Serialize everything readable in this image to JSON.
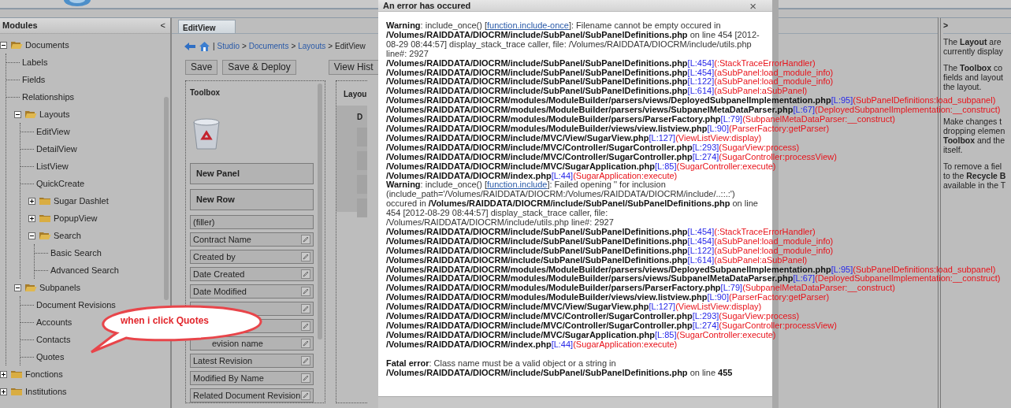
{
  "modules": {
    "title": "Modules",
    "collapse": "<",
    "tree": [
      {
        "label": "Documents",
        "kind": "folder",
        "expanded": true,
        "children": [
          {
            "label": "Labels",
            "kind": "leaf"
          },
          {
            "label": "Fields",
            "kind": "leaf"
          },
          {
            "label": "Relationships",
            "kind": "leaf"
          },
          {
            "label": "Layouts",
            "kind": "folder",
            "expanded": true,
            "children": [
              {
                "label": "EditView",
                "kind": "leaf"
              },
              {
                "label": "DetailView",
                "kind": "leaf"
              },
              {
                "label": "ListView",
                "kind": "leaf"
              },
              {
                "label": "QuickCreate",
                "kind": "leaf"
              },
              {
                "label": "Sugar Dashlet",
                "kind": "folder",
                "expanded": false
              },
              {
                "label": "PopupView",
                "kind": "folder",
                "expanded": false
              },
              {
                "label": "Search",
                "kind": "folder",
                "expanded": true,
                "children": [
                  {
                    "label": "Basic Search",
                    "kind": "leaf"
                  },
                  {
                    "label": "Advanced Search",
                    "kind": "leaf"
                  }
                ]
              }
            ]
          },
          {
            "label": "Subpanels",
            "kind": "folder",
            "expanded": true,
            "children": [
              {
                "label": "Document Revisions",
                "kind": "leaf"
              },
              {
                "label": "Accounts",
                "kind": "leaf"
              },
              {
                "label": "Contacts",
                "kind": "leaf"
              },
              {
                "label": "Quotes",
                "kind": "leaf"
              }
            ]
          }
        ]
      },
      {
        "label": "Fonctions",
        "kind": "folder",
        "expanded": false
      },
      {
        "label": "Institutions",
        "kind": "folder",
        "expanded": false
      }
    ]
  },
  "editor": {
    "tabs": [
      {
        "label": "EditView",
        "selected": true
      }
    ],
    "crumb_lead": "|",
    "crumb_separator": ">",
    "breadcrumb": [
      {
        "label": "Studio",
        "kind": "link"
      },
      {
        "label": "Documents",
        "kind": "link"
      },
      {
        "label": "Layouts",
        "kind": "link"
      },
      {
        "label": "EditView",
        "kind": "current"
      }
    ],
    "buttons": [
      "Save",
      "Save & Deploy"
    ],
    "history_button": "View Hist",
    "toolbox": {
      "title": "Toolbox",
      "items": [
        {
          "kind": "panel",
          "label": "New Panel"
        },
        {
          "kind": "panel",
          "label": "New Row"
        },
        {
          "kind": "filler",
          "label": "(filler)"
        },
        {
          "kind": "field",
          "label": "Contract Name"
        },
        {
          "kind": "field",
          "label": "Created by"
        },
        {
          "kind": "field",
          "label": "Date Created"
        },
        {
          "kind": "field",
          "label": "Date Modified"
        },
        {
          "kind": "field"
        },
        {
          "kind": "field"
        },
        {
          "kind": "field",
          "label": "evision name"
        },
        {
          "kind": "field",
          "label": "Latest Revision"
        },
        {
          "kind": "field",
          "label": "Modified By Name"
        },
        {
          "kind": "field",
          "label": "Related Document Revision"
        }
      ]
    },
    "layout": {
      "title": "Layou",
      "panel_label": "D"
    }
  },
  "dialog": {
    "title": "An error has occured",
    "close": "×",
    "messages": [
      {
        "kind": "warning",
        "before": "**Warning**: include_once() [",
        "link": "function.include-once",
        "after": "]: Filename cannot be empty occured in **/Volumes/RAIDDATA/DIOCRM/include/SubPanel/SubPanelDefinitions.php** on line 454 [2012-08-29 08:44:57] display_stack_trace caller, file: /Volumes/RAIDDATA/DIOCRM/include/utils.php line#: 2927"
      },
      {
        "kind": "trace",
        "file": "/Volumes/RAIDDATA/DIOCRM/include/SubPanel/SubPanelDefinitions.php",
        "line_ref": "[L:454]",
        "call": "(:StackTraceErrorHandler)"
      },
      {
        "kind": "trace",
        "file": "/Volumes/RAIDDATA/DIOCRM/include/SubPanel/SubPanelDefinitions.php",
        "line_ref": "[L:454]",
        "call": "(aSubPanel:load_module_info)"
      },
      {
        "kind": "trace",
        "file": "/Volumes/RAIDDATA/DIOCRM/include/SubPanel/SubPanelDefinitions.php",
        "line_ref": "[L:122]",
        "call": "(aSubPanel:load_module_info)"
      },
      {
        "kind": "trace",
        "file": "/Volumes/RAIDDATA/DIOCRM/include/SubPanel/SubPanelDefinitions.php",
        "line_ref": "[L:614]",
        "call": "(aSubPanel:aSubPanel)"
      },
      {
        "kind": "trace",
        "file": "/Volumes/RAIDDATA/DIOCRM/modules/ModuleBuilder/parsers/views/DeployedSubpanelImplementation.php",
        "line_ref": "[L:95]",
        "call": "(SubPanelDefinitions:load_subpanel)"
      },
      {
        "kind": "trace",
        "file": "/Volumes/RAIDDATA/DIOCRM/modules/ModuleBuilder/parsers/views/SubpanelMetaDataParser.php",
        "line_ref": "[L:67]",
        "call": "(DeployedSubpanelImplementation:__construct)"
      },
      {
        "kind": "trace",
        "file": "/Volumes/RAIDDATA/DIOCRM/modules/ModuleBuilder/parsers/ParserFactory.php",
        "line_ref": "[L:79]",
        "call": "(SubpanelMetaDataParser:__construct)"
      },
      {
        "kind": "trace",
        "file": "/Volumes/RAIDDATA/DIOCRM/modules/ModuleBuilder/views/view.listview.php",
        "line_ref": "[L:90]",
        "call": "(ParserFactory:getParser)"
      },
      {
        "kind": "trace",
        "file": "/Volumes/RAIDDATA/DIOCRM/include/MVC/View/SugarView.php",
        "line_ref": "[L:127]",
        "call": "(ViewListView:display)"
      },
      {
        "kind": "trace",
        "file": "/Volumes/RAIDDATA/DIOCRM/include/MVC/Controller/SugarController.php",
        "line_ref": "[L:293]",
        "call": "(SugarView:process)"
      },
      {
        "kind": "trace",
        "file": "/Volumes/RAIDDATA/DIOCRM/include/MVC/Controller/SugarController.php",
        "line_ref": "[L:274]",
        "call": "(SugarController:processView)"
      },
      {
        "kind": "trace",
        "file": "/Volumes/RAIDDATA/DIOCRM/include/MVC/SugarApplication.php",
        "line_ref": "[L:85]",
        "call": "(SugarController:execute)"
      },
      {
        "kind": "trace",
        "file": "/Volumes/RAIDDATA/DIOCRM/index.php",
        "line_ref": "[L:44]",
        "call": "(SugarApplication:execute)"
      },
      {
        "kind": "warning",
        "before": "**Warning**: include_once() [",
        "link": "function.include",
        "after": "]: Failed opening '' for inclusion (include_path='/Volumes/RAIDDATA/DIOCRM:/Volumes/RAIDDATA/DIOCRM/include/..::.:') occured in **/Volumes/RAIDDATA/DIOCRM/include/SubPanel/SubPanelDefinitions.php** on line 454 [2012-08-29 08:44:57] display_stack_trace caller, file: /Volumes/RAIDDATA/DIOCRM/include/utils.php line#: 2927"
      },
      {
        "kind": "trace",
        "file": "/Volumes/RAIDDATA/DIOCRM/include/SubPanel/SubPanelDefinitions.php",
        "line_ref": "[L:454]",
        "call": "(:StackTraceErrorHandler)"
      },
      {
        "kind": "trace",
        "file": "/Volumes/RAIDDATA/DIOCRM/include/SubPanel/SubPanelDefinitions.php",
        "line_ref": "[L:454]",
        "call": "(aSubPanel:load_module_info)"
      },
      {
        "kind": "trace",
        "file": "/Volumes/RAIDDATA/DIOCRM/include/SubPanel/SubPanelDefinitions.php",
        "line_ref": "[L:122]",
        "call": "(aSubPanel:load_module_info)"
      },
      {
        "kind": "trace",
        "file": "/Volumes/RAIDDATA/DIOCRM/include/SubPanel/SubPanelDefinitions.php",
        "line_ref": "[L:614]",
        "call": "(aSubPanel:aSubPanel)"
      },
      {
        "kind": "trace",
        "file": "/Volumes/RAIDDATA/DIOCRM/modules/ModuleBuilder/parsers/views/DeployedSubpanelImplementation.php",
        "line_ref": "[L:95]",
        "call": "(SubPanelDefinitions:load_subpanel)"
      },
      {
        "kind": "trace",
        "file": "/Volumes/RAIDDATA/DIOCRM/modules/ModuleBuilder/parsers/views/SubpanelMetaDataParser.php",
        "line_ref": "[L:67]",
        "call": "(DeployedSubpanelImplementation:__construct)"
      },
      {
        "kind": "trace",
        "file": "/Volumes/RAIDDATA/DIOCRM/modules/ModuleBuilder/parsers/ParserFactory.php",
        "line_ref": "[L:79]",
        "call": "(SubpanelMetaDataParser:__construct)"
      },
      {
        "kind": "trace",
        "file": "/Volumes/RAIDDATA/DIOCRM/modules/ModuleBuilder/views/view.listview.php",
        "line_ref": "[L:90]",
        "call": "(ParserFactory:getParser)"
      },
      {
        "kind": "trace",
        "file": "/Volumes/RAIDDATA/DIOCRM/include/MVC/View/SugarView.php",
        "line_ref": "[L:127]",
        "call": "(ViewListView:display)"
      },
      {
        "kind": "trace",
        "file": "/Volumes/RAIDDATA/DIOCRM/include/MVC/Controller/SugarController.php",
        "line_ref": "[L:293]",
        "call": "(SugarView:process)"
      },
      {
        "kind": "trace",
        "file": "/Volumes/RAIDDATA/DIOCRM/include/MVC/Controller/SugarController.php",
        "line_ref": "[L:274]",
        "call": "(SugarController:processView)"
      },
      {
        "kind": "trace",
        "file": "/Volumes/RAIDDATA/DIOCRM/include/MVC/SugarApplication.php",
        "line_ref": "[L:85]",
        "call": "(SugarController:execute)"
      },
      {
        "kind": "trace",
        "file": "/Volumes/RAIDDATA/DIOCRM/index.php",
        "line_ref": "[L:44]",
        "call": "(SugarApplication:execute)"
      },
      {
        "kind": "fatal",
        "text": "**Fatal error**: Class name must be a valid object or a string in **/Volumes/RAIDDATA/DIOCRM/include/SubPanel/SubPanelDefinitions.php** on line **455**"
      }
    ]
  },
  "help": {
    "expand": ">",
    "paragraphs": [
      {
        "lines": [
          "The **Layout** are",
          "currently display"
        ]
      },
      {
        "lines": [
          "The **Toolbox** co",
          "fields and layout",
          "the layout."
        ]
      },
      {
        "lines": [
          "Make changes t",
          "dropping elemen",
          "**Toolbox** and the",
          "itself."
        ]
      },
      {
        "lines": [
          "To remove a fiel",
          "to the **Recycle B**",
          "available in the T"
        ]
      }
    ]
  },
  "annotation": {
    "text": "when i click Quotes"
  }
}
